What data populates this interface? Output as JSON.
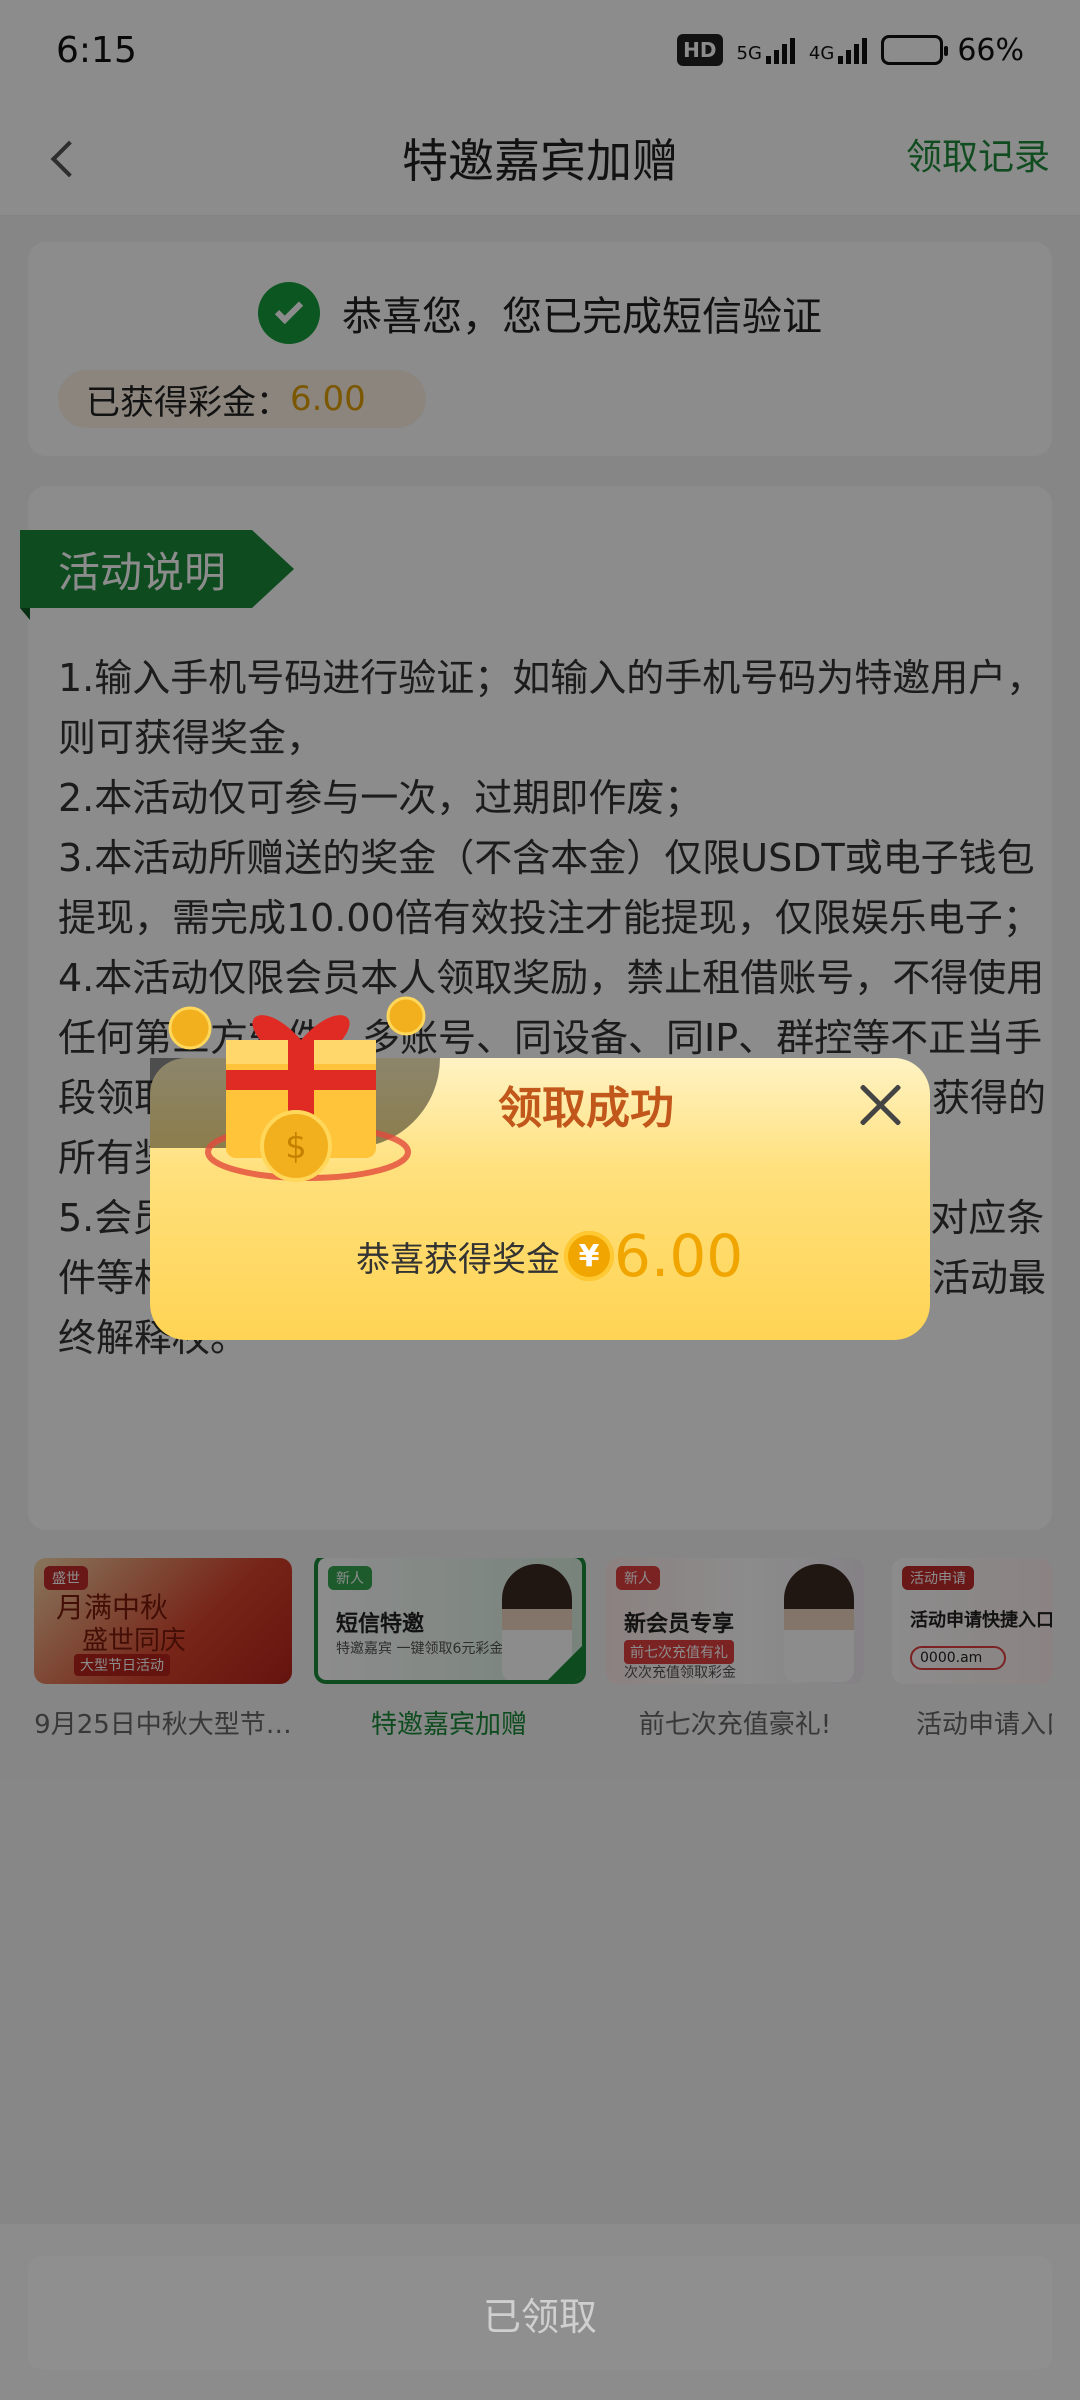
{
  "status_bar": {
    "time": "6:15",
    "hd": "HD",
    "net_a": "5G",
    "net_b": "4G",
    "battery": "66%",
    "battery_level": 0.66
  },
  "header": {
    "title": "特邀嘉宾加赠",
    "records_link": "领取记录"
  },
  "verify_card": {
    "message": "恭喜您，您已完成短信验证",
    "bonus_label": "已获得彩金：",
    "bonus_value": "6.00"
  },
  "rules_card": {
    "ribbon_title": "活动说明",
    "rules": [
      "1.输入手机号码进行验证；如输入的手机号码为特邀用户，则可获得奖金，",
      "2.本活动仅可参与一次，过期即作废；",
      "3.本活动所赠送的奖金（不含本金）仅限USDT或电子钱包提现，需完成10.00倍有效投注才能提现，仅限娱乐电子；",
      "4.本活动仅限会员本人领取奖励，禁止租借账号，不得使用任何第三方软件、多账号、同设备、同IP、群控等不正当手段领取，一经发现本平台有权终止活动并扣除该会员获得的所有奖金和不当得利；",
      "5.会员参与该活动时，本平台将默认会员同意且遵守对应条件等相关规定，为避免文字理解歧义，本平台保有本活动最终解释权。"
    ]
  },
  "promos": [
    {
      "caption": "9月25日中秋大型节…",
      "tag": "盛世",
      "title_a": "月满中秋",
      "title_b": "盛世同庆",
      "sub": "大型节日活动",
      "active": false
    },
    {
      "caption": "特邀嘉宾加赠",
      "tag": "新人",
      "title_a": "短信特邀",
      "sub": "特邀嘉宾 一键领取6元彩金",
      "active": true
    },
    {
      "caption": "前七次充值豪礼!",
      "tag": "新人",
      "title_a": "新会员专享",
      "tagline": "前七次充值有礼",
      "sub": "次次充值领取彩金",
      "active": false
    },
    {
      "caption": "活动申请入口",
      "tag": "活动申请",
      "title_a": "活动申请快捷入口",
      "pill": "0000.am",
      "active": false
    }
  ],
  "bottom": {
    "button_label": "已领取"
  },
  "modal": {
    "title": "领取成功",
    "message": "恭喜获得奖金",
    "currency": "¥",
    "amount": "6.00"
  },
  "colors": {
    "brand_green": "#1a8a3a",
    "gold": "#f0a500",
    "modal_title": "#c1571a"
  }
}
